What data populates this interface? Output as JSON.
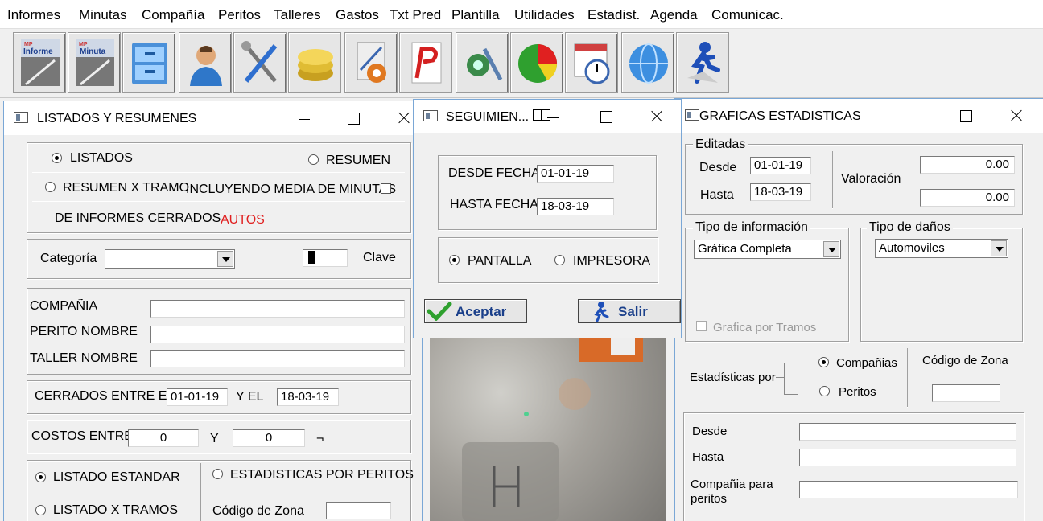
{
  "menu": [
    "Informes",
    "Minutas",
    "Compañía",
    "Peritos",
    "Talleres",
    "Gastos",
    "Txt Pred",
    "Plantilla",
    "Utilidades",
    "Estadist.",
    "Agenda",
    "Comunicac."
  ],
  "toolbar": {
    "informe_label": "Informe",
    "minuta_label": "Minuta",
    "mp_label": "MP"
  },
  "listados": {
    "title": "LISTADOS Y RESUMENES",
    "opt_listados": "LISTADOS",
    "opt_resumen": "RESUMEN",
    "opt_resumen_tramo": "RESUMEN X TRAMO",
    "incluyendo": "INCLUYENDO MEDIA DE MINUTAS",
    "de_informes": "DE  INFORMES CERRADOS",
    "autos": "AUTOS",
    "categoria_label": "Categoría",
    "categoria_value": "",
    "clave_label": "Clave",
    "compania_label": "COMPAÑIA",
    "perito_label": "PERITO NOMBRE",
    "taller_label": "TALLER NOMBRE",
    "cerrados_label": "CERRADOS ENTRE EL",
    "cerrados_from": "01-01-19",
    "y_el": "Y EL",
    "cerrados_to": "18-03-19",
    "costos_label": "COSTOS ENTRE",
    "costos_from": "0",
    "y": "Y",
    "costos_to": "0",
    "costos_suffix": "¬",
    "opt_estandar": "LISTADO ESTANDAR",
    "opt_est_peritos": "ESTADISTICAS POR PERITOS",
    "opt_tramos": "LISTADO X TRAMOS",
    "codigo_zona": "Código de Zona"
  },
  "seguimiento": {
    "title": "SEGUIMIEN...",
    "desde_label": "DESDE FECHA",
    "desde_value": "01-01-19",
    "hasta_label": "HASTA FECHA",
    "hasta_value": "18-03-19",
    "opt_pantalla": "PANTALLA",
    "opt_impresora": "IMPRESORA",
    "aceptar": "Aceptar",
    "salir": "Salir"
  },
  "graficas": {
    "title": "GRAFICAS ESTADISTICAS",
    "editadas": "Editadas",
    "desde_label": "Desde",
    "desde_value": "01-01-19",
    "hasta_label": "Hasta",
    "hasta_value": "18-03-19",
    "valoracion": "Valoración",
    "val1": "0.00",
    "val2": "0.00",
    "tipo_info": "Tipo de información",
    "tipo_info_value": "Gráfica Completa",
    "tipo_danos": "Tipo de daños",
    "tipo_danos_value": "Automoviles",
    "grafica_tramos": "Grafica por Tramos",
    "estadisticas_por": "Estadísticas por",
    "opt_companias": "Compañias",
    "opt_peritos": "Peritos",
    "codigo_zona": "Código de Zona",
    "desde2": "Desde",
    "hasta2": "Hasta",
    "compania_para": "Compañia para",
    "peritos": "peritos"
  }
}
